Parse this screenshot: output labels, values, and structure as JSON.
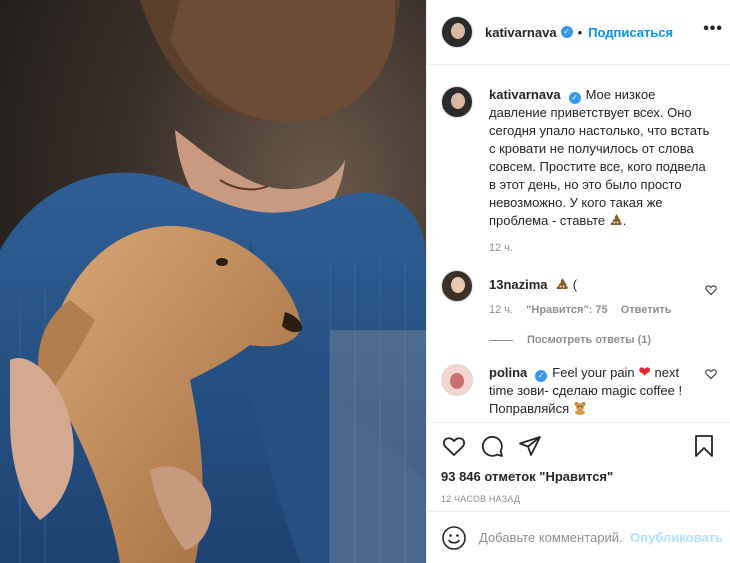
{
  "post": {
    "author": "kativarnava",
    "follow_label": "Подписаться",
    "separator": "•",
    "more_label": "•••"
  },
  "caption": {
    "username": "kativarnava",
    "text": "Мое низкое давление приветствует всех. Оно сегодня упало настолько, что встать с кровати не получилось от слова совсем. Простите все, кого подвела в этот день, но это было просто невозможно. У кого такая же проблема - ставьте",
    "emoji": "poop-emoji",
    "text_end": ".",
    "time": "12 ч."
  },
  "comments": [
    {
      "username": "13nazima",
      "emoji": "poop-emoji",
      "text_after": " (",
      "time": "12 ч.",
      "likes": "\"Нравится\": 75",
      "reply": "Ответить",
      "view_replies": "Посмотреть ответы (1)"
    },
    {
      "username": "polina",
      "text_before": "Feel your pain",
      "text_after": " next time зови- сделаю magic coffee ! Поправляйся",
      "emoji": "teddy-bear-emoji"
    }
  ],
  "actions": {
    "likes": "93 846 отметок \"Нравится\"",
    "posted": "12 часов назад"
  },
  "composer": {
    "placeholder": "Добавьте комментарий...",
    "publish_label": "Опубликовать"
  },
  "colors": {
    "accent": "#0095f6",
    "publish_disabled": "#b2dffc",
    "verified": "#3897f0",
    "heart": "#e8282f",
    "muted": "#8e8e8e"
  }
}
